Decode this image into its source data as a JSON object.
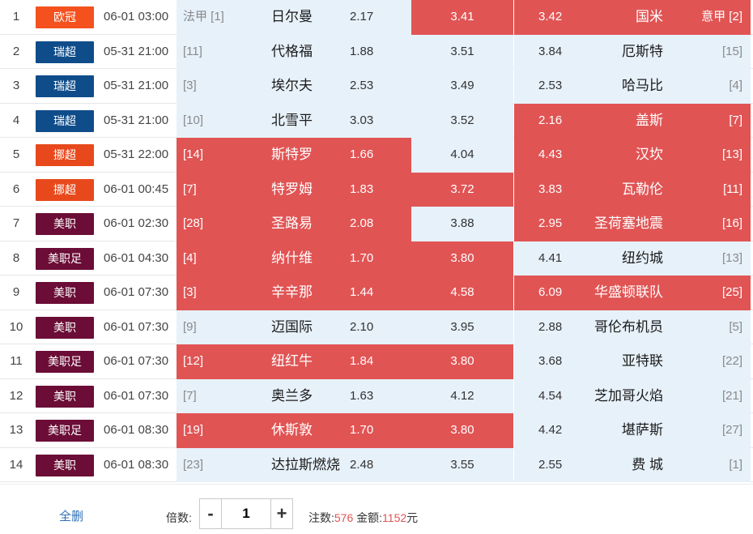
{
  "matches": [
    {
      "idx": "1",
      "league": "欧冠",
      "league_color": "#f4511e",
      "time": "06-01 03:00",
      "home_rank": "法甲 [1]",
      "home": "日尔曼",
      "odds_home": "2.17",
      "odds_draw": "3.41",
      "odds_away": "3.42",
      "away": "国米",
      "away_rank": "意甲 [2]",
      "sel": [
        "draw",
        "away"
      ]
    },
    {
      "idx": "2",
      "league": "瑞超",
      "league_color": "#0f4c8a",
      "time": "05-31 21:00",
      "home_rank": "[11]",
      "home": "代格福",
      "odds_home": "1.88",
      "odds_draw": "3.51",
      "odds_away": "3.84",
      "away": "厄斯特",
      "away_rank": "[15]",
      "sel": []
    },
    {
      "idx": "3",
      "league": "瑞超",
      "league_color": "#0f4c8a",
      "time": "05-31 21:00",
      "home_rank": "[3]",
      "home": "埃尔夫",
      "odds_home": "2.53",
      "odds_draw": "3.49",
      "odds_away": "2.53",
      "away": "哈马比",
      "away_rank": "[4]",
      "sel": []
    },
    {
      "idx": "4",
      "league": "瑞超",
      "league_color": "#0f4c8a",
      "time": "05-31 21:00",
      "home_rank": "[10]",
      "home": "北雪平",
      "odds_home": "3.03",
      "odds_draw": "3.52",
      "odds_away": "2.16",
      "away": "盖斯",
      "away_rank": "[7]",
      "sel": [
        "away"
      ]
    },
    {
      "idx": "5",
      "league": "挪超",
      "league_color": "#e8491c",
      "time": "05-31 22:00",
      "home_rank": "[14]",
      "home": "斯特罗",
      "odds_home": "1.66",
      "odds_draw": "4.04",
      "odds_away": "4.43",
      "away": "汉坎",
      "away_rank": "[13]",
      "sel": [
        "home",
        "away"
      ]
    },
    {
      "idx": "6",
      "league": "挪超",
      "league_color": "#e8491c",
      "time": "06-01 00:45",
      "home_rank": "[7]",
      "home": "特罗姆",
      "odds_home": "1.83",
      "odds_draw": "3.72",
      "odds_away": "3.83",
      "away": "瓦勒伦",
      "away_rank": "[11]",
      "sel": [
        "home",
        "draw",
        "away"
      ]
    },
    {
      "idx": "7",
      "league": "美职",
      "league_color": "#6b0d36",
      "time": "06-01 02:30",
      "home_rank": "[28]",
      "home": "圣路易",
      "odds_home": "2.08",
      "odds_draw": "3.88",
      "odds_away": "2.95",
      "away": "圣荷塞地震",
      "away_rank": "[16]",
      "sel": [
        "home",
        "away"
      ]
    },
    {
      "idx": "8",
      "league": "美职足",
      "league_color": "#6b0d36",
      "time": "06-01 04:30",
      "home_rank": "[4]",
      "home": "纳什维",
      "odds_home": "1.70",
      "odds_draw": "3.80",
      "odds_away": "4.41",
      "away": "纽约城",
      "away_rank": "[13]",
      "sel": [
        "home",
        "draw"
      ]
    },
    {
      "idx": "9",
      "league": "美职",
      "league_color": "#6b0d36",
      "time": "06-01 07:30",
      "home_rank": "[3]",
      "home": "辛辛那",
      "odds_home": "1.44",
      "odds_draw": "4.58",
      "odds_away": "6.09",
      "away": "华盛顿联队",
      "away_rank": "[25]",
      "sel": [
        "home",
        "draw",
        "away"
      ]
    },
    {
      "idx": "10",
      "league": "美职",
      "league_color": "#6b0d36",
      "time": "06-01 07:30",
      "home_rank": "[9]",
      "home": "迈国际",
      "odds_home": "2.10",
      "odds_draw": "3.95",
      "odds_away": "2.88",
      "away": "哥伦布机员",
      "away_rank": "[5]",
      "sel": []
    },
    {
      "idx": "11",
      "league": "美职足",
      "league_color": "#6b0d36",
      "time": "06-01 07:30",
      "home_rank": "[12]",
      "home": "纽红牛",
      "odds_home": "1.84",
      "odds_draw": "3.80",
      "odds_away": "3.68",
      "away": "亚特联",
      "away_rank": "[22]",
      "sel": [
        "home",
        "draw"
      ]
    },
    {
      "idx": "12",
      "league": "美职",
      "league_color": "#6b0d36",
      "time": "06-01 07:30",
      "home_rank": "[7]",
      "home": "奥兰多",
      "odds_home": "1.63",
      "odds_draw": "4.12",
      "odds_away": "4.54",
      "away": "芝加哥火焰",
      "away_rank": "[21]",
      "sel": []
    },
    {
      "idx": "13",
      "league": "美职足",
      "league_color": "#6b0d36",
      "time": "06-01 08:30",
      "home_rank": "[19]",
      "home": "休斯敦",
      "odds_home": "1.70",
      "odds_draw": "3.80",
      "odds_away": "4.42",
      "away": "堪萨斯",
      "away_rank": "[27]",
      "sel": [
        "home",
        "draw"
      ]
    },
    {
      "idx": "14",
      "league": "美职",
      "league_color": "#6b0d36",
      "time": "06-01 08:30",
      "home_rank": "[23]",
      "home": "达拉斯燃烧",
      "odds_home": "2.48",
      "odds_draw": "3.55",
      "odds_away": "2.55",
      "away": "费 城",
      "away_rank": "[1]",
      "sel": []
    }
  ],
  "footer": {
    "clear_all": "全删",
    "multiplier_label": "倍数:",
    "minus": "-",
    "plus": "+",
    "multiplier_value": "1",
    "bets_label": "注数:",
    "bets_value": "576",
    "amount_label": "金额:",
    "amount_value": "1152",
    "amount_unit": "元"
  },
  "colors": {
    "selected": "#e15454",
    "unselected": "#e7f1fa",
    "accent": "#2f6fb5"
  }
}
